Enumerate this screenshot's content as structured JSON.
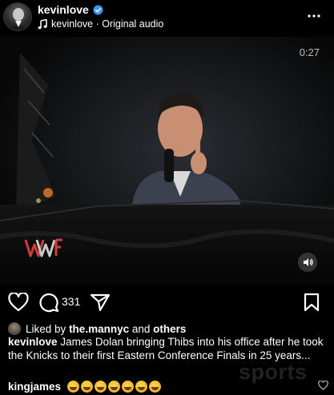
{
  "header": {
    "username": "kevinlove",
    "audio_text": "kevinlove · Original audio",
    "icons": {
      "verified": "verified-badge-icon",
      "music": "music-note-icon",
      "more": "more-icon"
    }
  },
  "video": {
    "duration": "0:27",
    "watermark_logo": "WWF",
    "icons": {
      "sound": "speaker-icon"
    }
  },
  "actions": {
    "comment_count": "331",
    "icons": [
      "heart-icon",
      "comment-icon",
      "share-icon",
      "bookmark-icon"
    ]
  },
  "likes": {
    "prefix": "Liked by",
    "user": "the.mannyc",
    "conj": "and",
    "others": "others"
  },
  "caption": {
    "username": "kevinlove",
    "text": "James Dolan bringing Thibs into his office after he took the Knicks to their first Eastern Conference Finals in 25 years..."
  },
  "overlay_watermark": "sports",
  "comment": {
    "username": "kingjames",
    "emoji_count": 7,
    "emoji_name": "rolling-on-floor-laughing"
  },
  "colors": {
    "background": "#000000",
    "verified": "#3897f0",
    "text": "#ffffff"
  }
}
